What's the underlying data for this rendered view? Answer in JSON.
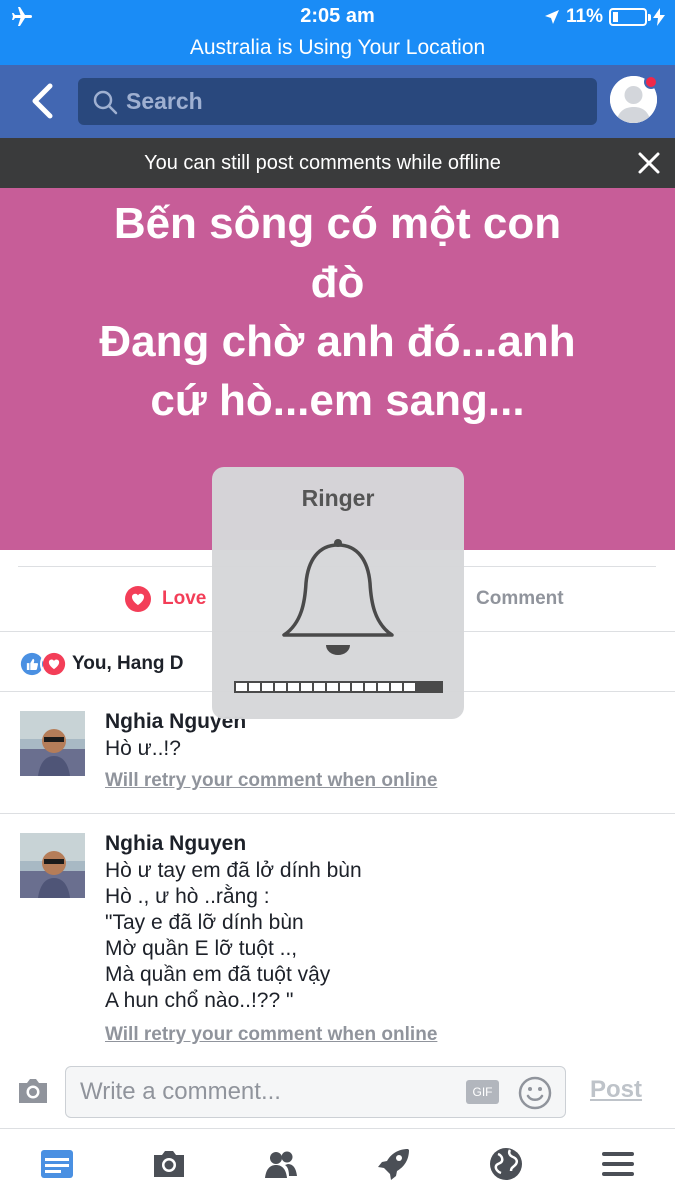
{
  "status_bar": {
    "time": "2:05 am",
    "battery": "11%",
    "location_banner": "Australia is Using Your Location"
  },
  "navbar": {
    "search_placeholder": "Search"
  },
  "offline_banner": "You can still post comments while offline",
  "post": {
    "text": "Bến sông có một con\nđò\nĐang chờ anh đó...anh\ncứ hò...em sang..."
  },
  "actions": {
    "love": "Love",
    "comment": "Comment"
  },
  "reactions": {
    "names": "You, Hang D"
  },
  "comments": [
    {
      "author": "Nghia Nguyen",
      "body": "Hò ư..!?",
      "status": "Will retry your comment when online"
    },
    {
      "author": "Nghia Nguyen",
      "body": "Hò ư tay em đã lở dính bùn\nHò ., ư hò ..rằng :\n\"Tay e đã lỡ dính bùn\nMờ quần E lỡ tuột ..,\nMà quần em đã tuột vậy\nA hun chổ nào..!?? \"",
      "status": "Will retry your comment when online"
    }
  ],
  "ringer": {
    "title": "Ringer",
    "level": 0.875
  },
  "composer": {
    "placeholder": "Write a comment...",
    "gif_label": "GIF",
    "post_label": "Post"
  },
  "colors": {
    "facebook_blue": "#4267b2",
    "status_blue": "#1a8cf6",
    "post_background": "#c75d98",
    "love_red": "#f33e58"
  },
  "tabs": [
    "news-feed-icon",
    "camera-icon",
    "friends-icon",
    "explore-rocket-icon",
    "globe-icon",
    "menu-icon"
  ]
}
